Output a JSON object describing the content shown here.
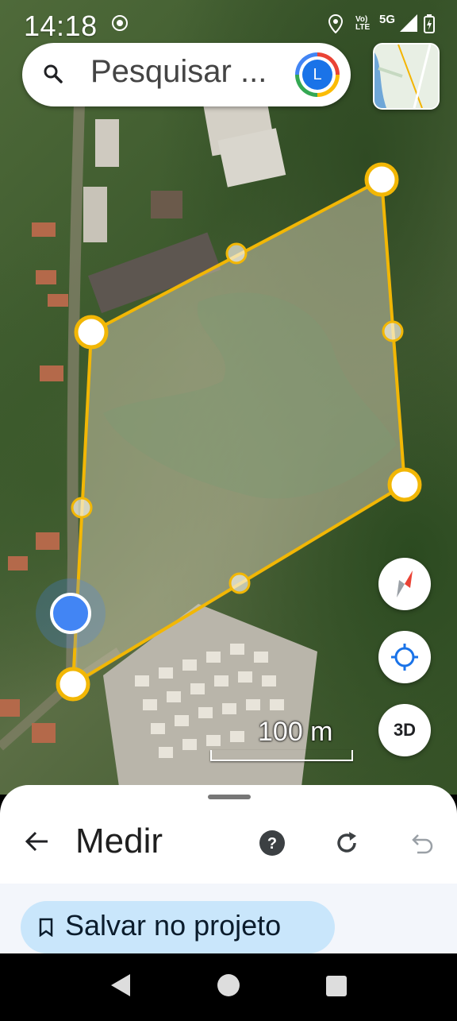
{
  "status_bar": {
    "time": "14:18",
    "network_label": "5G",
    "lte_label": "Vo)\nLTE",
    "icons": [
      "whatsapp-icon",
      "location-icon",
      "signal-icon",
      "battery-charging-icon"
    ]
  },
  "search": {
    "placeholder": "Pesquisar ...",
    "avatar_letter": "L"
  },
  "map": {
    "scale_label": "100 m",
    "polygon_color": "#f2b705",
    "user_location_color": "#4285f4"
  },
  "fabs": {
    "three_d_label": "3D"
  },
  "sheet": {
    "title": "Medir",
    "save_label": "Salvar no projeto"
  },
  "colors": {
    "accent": "#1a73e8",
    "chip_bg": "#c9e6fb"
  }
}
